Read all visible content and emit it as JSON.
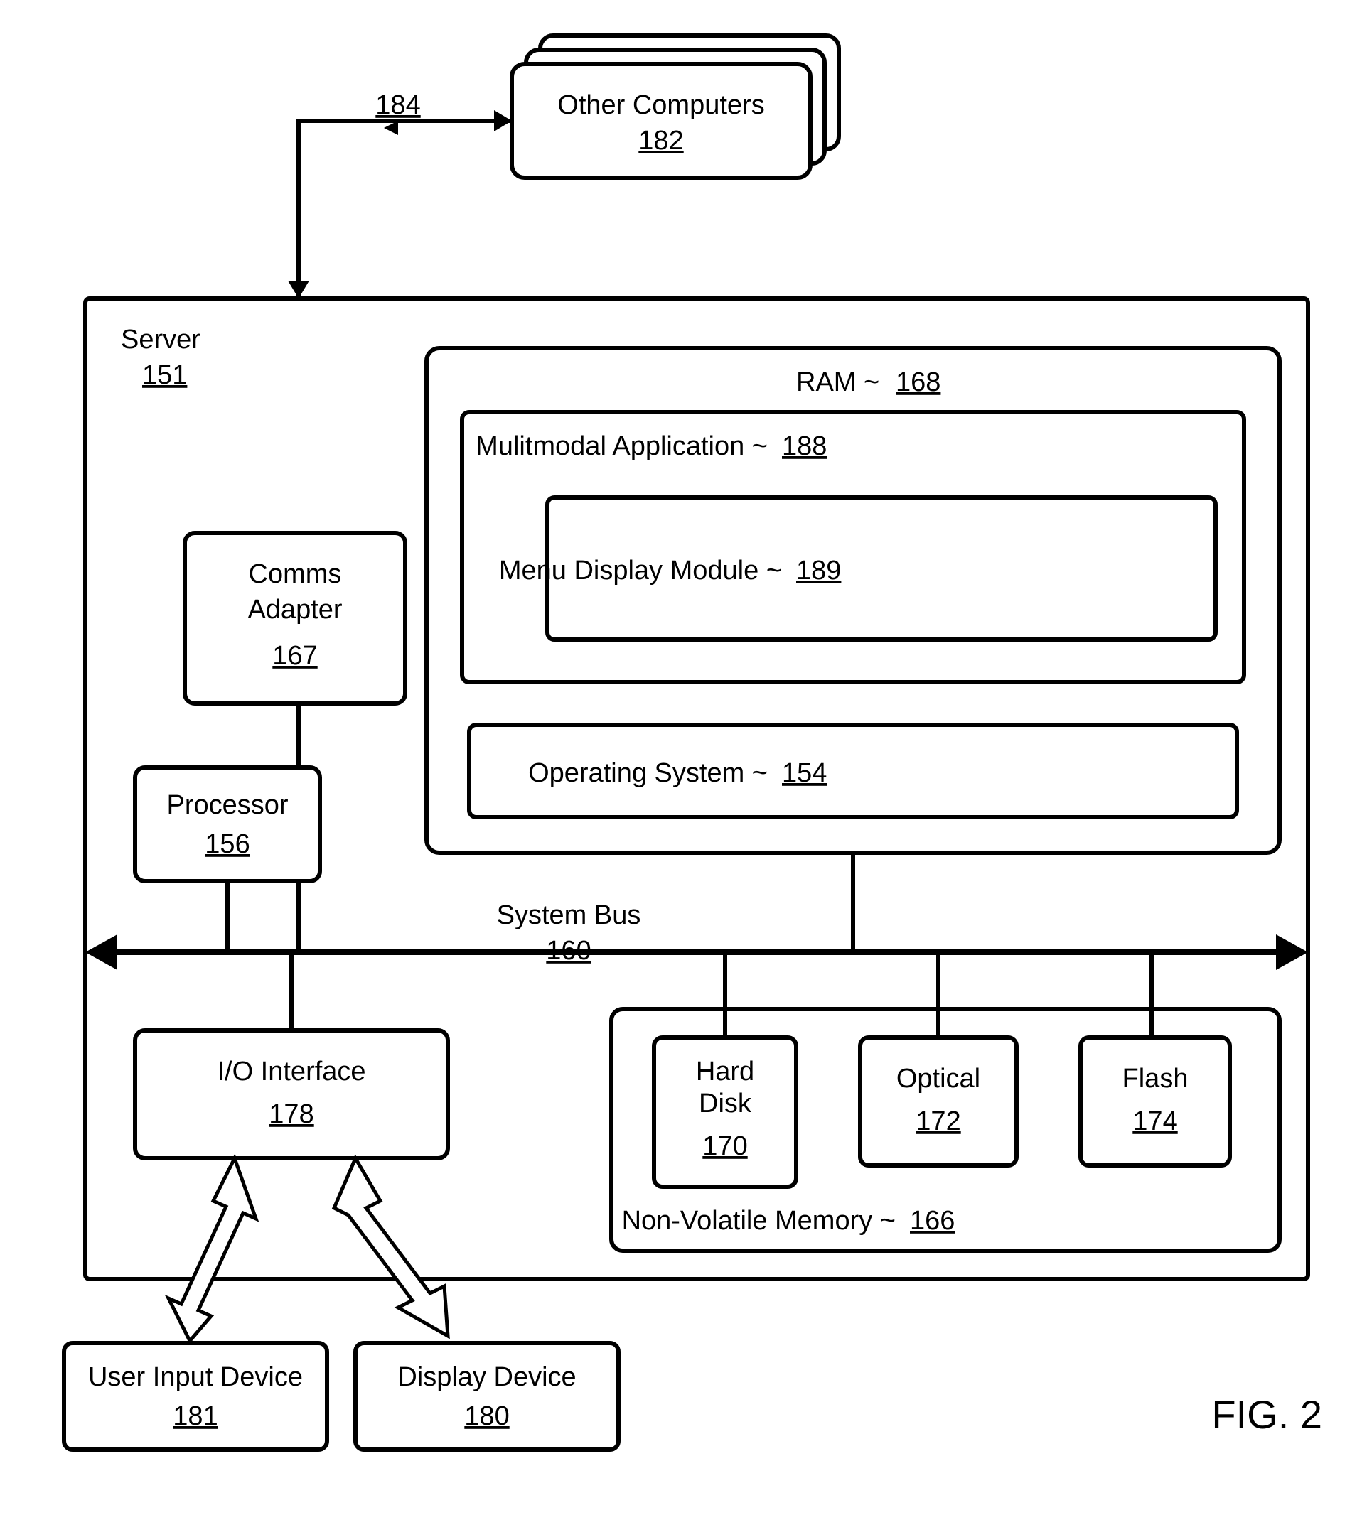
{
  "figure_label": "FIG. 2",
  "external": {
    "other_computers": {
      "label": "Other Computers",
      "num": "182"
    },
    "link_num": "184"
  },
  "server": {
    "label": "Server",
    "num": "151",
    "comms_adapter": {
      "label1": "Comms",
      "label2": "Adapter",
      "num": "167"
    },
    "processor": {
      "label": "Processor",
      "num": "156"
    },
    "ram": {
      "label": "RAM ~",
      "num": "168",
      "application": {
        "label": "Mulitmodal Application ~",
        "num": "188",
        "module": {
          "label": "Menu Display Module ~",
          "num": "189"
        }
      },
      "os": {
        "label": "Operating System ~",
        "num": "154"
      }
    },
    "bus": {
      "label": "System Bus",
      "num": "160"
    },
    "io": {
      "label": "I/O Interface",
      "num": "178"
    },
    "nvm": {
      "label": "Non-Volatile Memory ~",
      "num": "166",
      "hard_disk": {
        "label1": "Hard",
        "label2": "Disk",
        "num": "170"
      },
      "optical": {
        "label": "Optical",
        "num": "172"
      },
      "flash": {
        "label": "Flash",
        "num": "174"
      }
    }
  },
  "peripherals": {
    "user_input": {
      "label": "User Input Device",
      "num": "181"
    },
    "display": {
      "label": "Display Device",
      "num": "180"
    }
  }
}
